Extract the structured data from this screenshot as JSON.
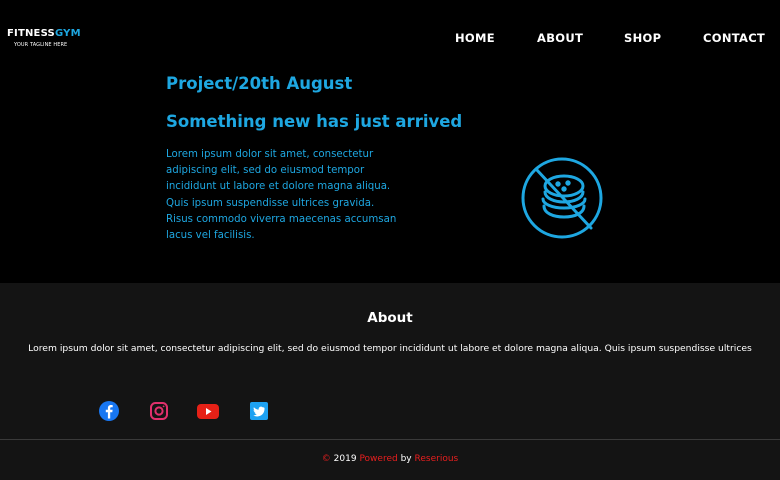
{
  "brand": {
    "name_part1": "FITNESS",
    "name_part2": "GYM",
    "tagline": "YOUR TAGLINE HERE",
    "accent_color": "#1ea7e1"
  },
  "nav": {
    "items": [
      {
        "label": "HOME"
      },
      {
        "label": "ABOUT"
      },
      {
        "label": "SHOP"
      },
      {
        "label": "CONTACT"
      }
    ]
  },
  "post": {
    "title": "Project/20th August",
    "subtitle": "Something new has just arrived",
    "body": "Lorem ipsum dolor sit amet, consectetur adipiscing elit, sed do eiusmod tempor incididunt ut labore et dolore magna aliqua. Quis ipsum suspendisse ultrices gravida. Risus commodo viverra maecenas accumsan lacus vel facilisis.",
    "icon": "no-burger-icon"
  },
  "footer": {
    "title": "About",
    "text": "Lorem ipsum dolor sit amet, consectetur adipiscing elit, sed do eiusmod tempor incididunt ut labore et dolore magna aliqua. Quis ipsum suspendisse ultrices",
    "social": [
      {
        "icon": "facebook-icon",
        "color": "#1877f2"
      },
      {
        "icon": "instagram-icon",
        "color": "#e1306c"
      },
      {
        "icon": "youtube-icon",
        "color": "#e62117"
      },
      {
        "icon": "twitter-icon",
        "color": "#1da1f2"
      }
    ]
  },
  "copyright": {
    "symbol": "©",
    "year": "2019",
    "powered": "Powered",
    "by": "by",
    "company": "Reserious",
    "highlight_color": "#e81f1f"
  }
}
